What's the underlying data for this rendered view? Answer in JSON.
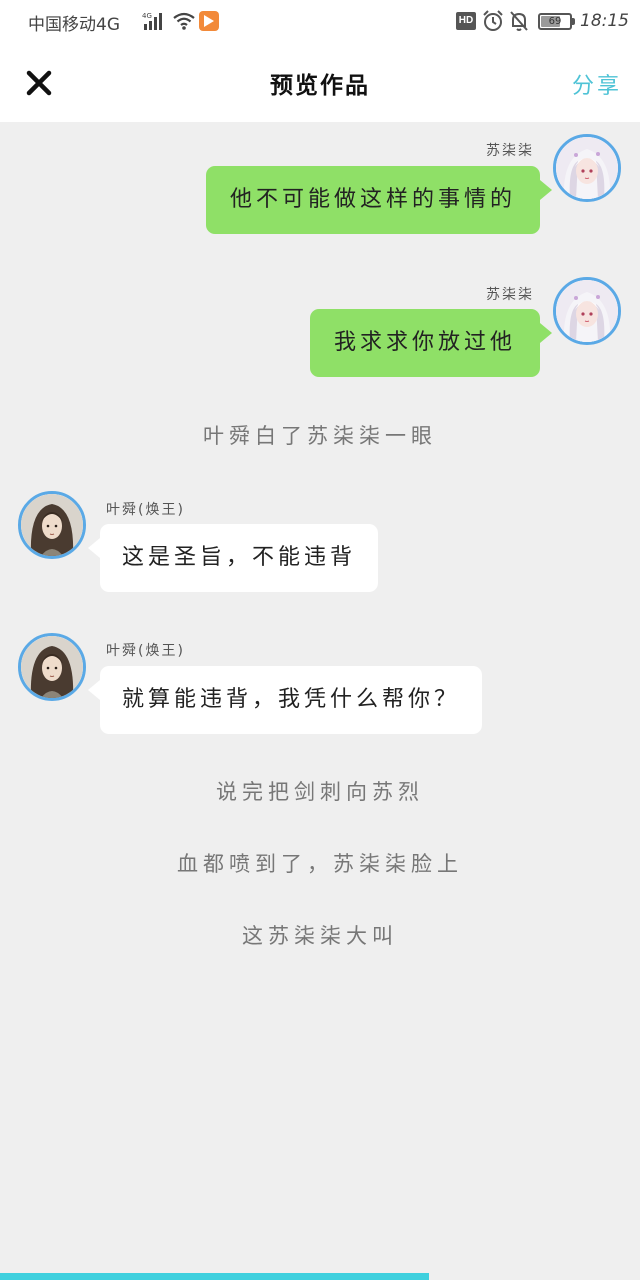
{
  "status_bar": {
    "carrier": "中国移动4G",
    "network_badge": "4G",
    "hd": "HD",
    "battery": "69",
    "battery_level": 0.69,
    "time": "18:15"
  },
  "header": {
    "close_icon": "close-icon",
    "title": "预览作品",
    "share_label": "分享"
  },
  "messages": [
    {
      "side": "right",
      "sender": "苏柒柒",
      "text": "他不可能做这样的事情的"
    },
    {
      "side": "right",
      "sender": "苏柒柒",
      "text": "我求求你放过他"
    },
    {
      "side": "center",
      "text": "叶舜白了苏柒柒一眼"
    },
    {
      "side": "left",
      "sender": "叶舜(焕王)",
      "text": "这是圣旨，不能违背"
    },
    {
      "side": "left",
      "sender": "叶舜(焕王)",
      "text": "就算能违背，我凭什么帮你？"
    },
    {
      "side": "center",
      "text": "说完把剑刺向苏烈"
    },
    {
      "side": "center",
      "text": "血都喷到了，苏柒柒脸上"
    },
    {
      "side": "center",
      "text": "这苏柒柒大叫"
    }
  ],
  "colors": {
    "accent": "#4fc3d6",
    "bubble_green": "#8fe067",
    "avatar_ring": "#5aa9e6",
    "background": "#efefef"
  },
  "progress": 0.67
}
